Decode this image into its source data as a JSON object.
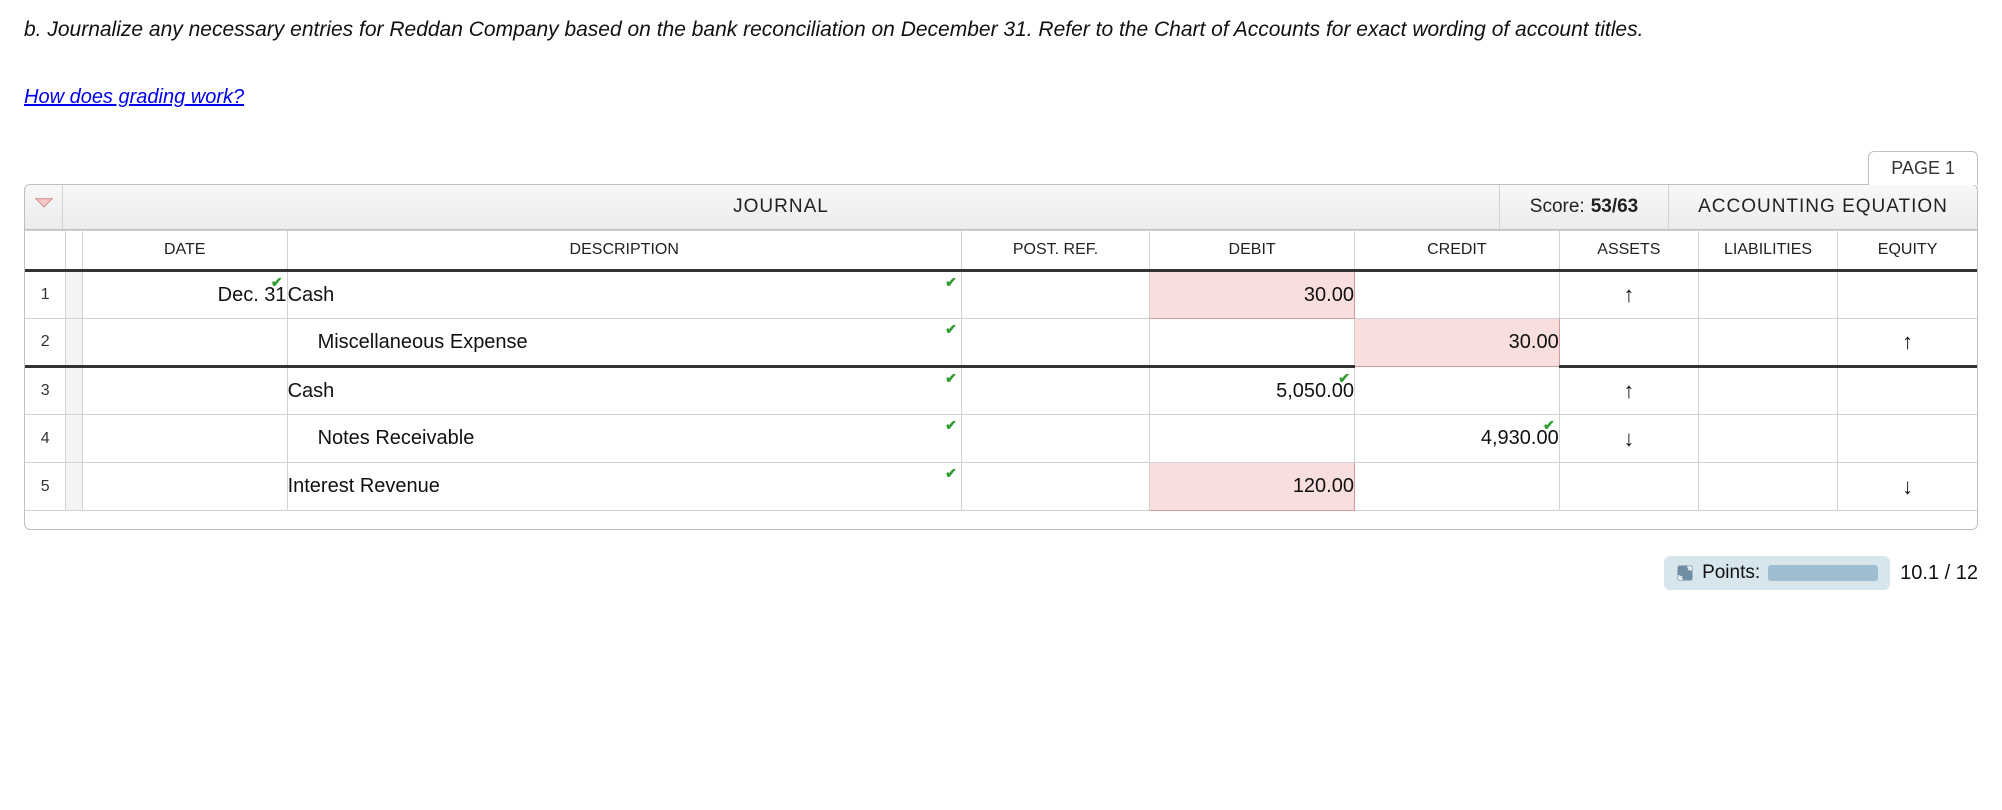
{
  "prompt": "b. Journalize any necessary entries for Reddan Company based on the bank reconciliation on December 31. Refer to the Chart of Accounts for exact wording of account titles.",
  "grading_link": "How does grading work?",
  "page_tab": "PAGE 1",
  "header": {
    "journal_title": "JOURNAL",
    "score_label": "Score:",
    "score_value": "53/63",
    "acct_eq_title": "ACCOUNTING EQUATION"
  },
  "columns": {
    "date": "DATE",
    "description": "DESCRIPTION",
    "postref": "POST. REF.",
    "debit": "DEBIT",
    "credit": "CREDIT",
    "assets": "ASSETS",
    "liabilities": "LIABILITIES",
    "equity": "EQUITY"
  },
  "rows": [
    {
      "num": "1",
      "date": "Dec. 31",
      "date_correct": true,
      "description": "Cash",
      "desc_indent": 0,
      "desc_correct": true,
      "debit": "30.00",
      "debit_wrong": true,
      "credit": "",
      "assets": "↑",
      "liabilities": "",
      "equity": "",
      "separator": false
    },
    {
      "num": "2",
      "date": "",
      "description": "Miscellaneous Expense",
      "desc_indent": 1,
      "desc_correct": true,
      "debit": "",
      "credit": "30.00",
      "credit_wrong": true,
      "assets": "",
      "liabilities": "",
      "equity": "↑",
      "separator": true
    },
    {
      "num": "3",
      "date": "",
      "description": "Cash",
      "desc_indent": 0,
      "desc_correct": true,
      "debit": "5,050.00",
      "debit_correct": true,
      "credit": "",
      "assets": "↑",
      "liabilities": "",
      "equity": "",
      "separator": false
    },
    {
      "num": "4",
      "date": "",
      "description": "Notes Receivable",
      "desc_indent": 1,
      "desc_correct": true,
      "debit": "",
      "credit": "4,930.00",
      "credit_correct": true,
      "assets": "↓",
      "liabilities": "",
      "equity": "",
      "separator": false
    },
    {
      "num": "5",
      "date": "",
      "description": "Interest Revenue",
      "desc_indent": 0,
      "desc_correct": true,
      "debit": "120.00",
      "debit_wrong": true,
      "credit": "",
      "assets": "",
      "liabilities": "",
      "equity": "↓",
      "separator": false
    }
  ],
  "points": {
    "label": "Points:",
    "value": "10.1 / 12"
  }
}
